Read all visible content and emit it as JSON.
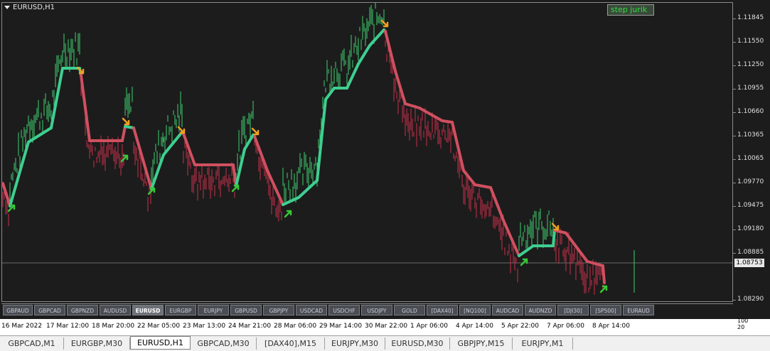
{
  "window": {
    "symbol_title": "EURUSD,H1"
  },
  "indicator_button": {
    "label": "step jurik"
  },
  "price_axis": {
    "labels": [
      "1.11845",
      "1.11550",
      "1.11250",
      "1.10955",
      "1.10660",
      "1.10365",
      "1.10065",
      "1.09770",
      "1.09475",
      "1.09180",
      "1.08885",
      "1.08290"
    ],
    "current_price": "1.08753",
    "volume_labels": [
      "100",
      "20"
    ]
  },
  "symbol_buttons": [
    "GBPAUD",
    "GBPCAD",
    "GBPNZD",
    "AUDUSD",
    "EURUSD",
    "EURGBP",
    "EURJPY",
    "GBPUSD",
    "GBPJPY",
    "USDCAD",
    "USDCHF",
    "USDJPY",
    "GOLD",
    "[DAX40]",
    "[NQ100]",
    "AUDCAD",
    "AUDNZD",
    "[DJI30]",
    "[SP500]",
    "EURAUD"
  ],
  "active_symbol": "EURUSD",
  "time_axis": [
    "16 Mar 2022",
    "17 Mar 12:00",
    "18 Mar 20:00",
    "22 Mar 05:00",
    "23 Mar 13:00",
    "24 Mar 21:00",
    "28 Mar 06:00",
    "29 Mar 14:00",
    "30 Mar 22:00",
    "1 Apr 06:00",
    "4 Apr 14:00",
    "5 Apr 22:00",
    "7 Apr 06:00",
    "8 Apr 14:00"
  ],
  "tabs": [
    "GBPCAD,M1",
    "EURGBP,M30",
    "EURUSD,H1",
    "GBPCAD,M30",
    "[DAX40],M15",
    "EURJPY,M30",
    "EURUSD,M30",
    "GBPJPY,M15",
    "EURJPY,M1"
  ],
  "active_tab": "EURUSD,H1",
  "colors": {
    "background": "#1c1c1c",
    "up_bar": "#3ecf6f",
    "down_bar": "#c8304a",
    "line_up": "#3ecf90",
    "line_down": "#d05060",
    "arrow_up": "#38c838",
    "arrow_down": "#f0a020"
  }
}
